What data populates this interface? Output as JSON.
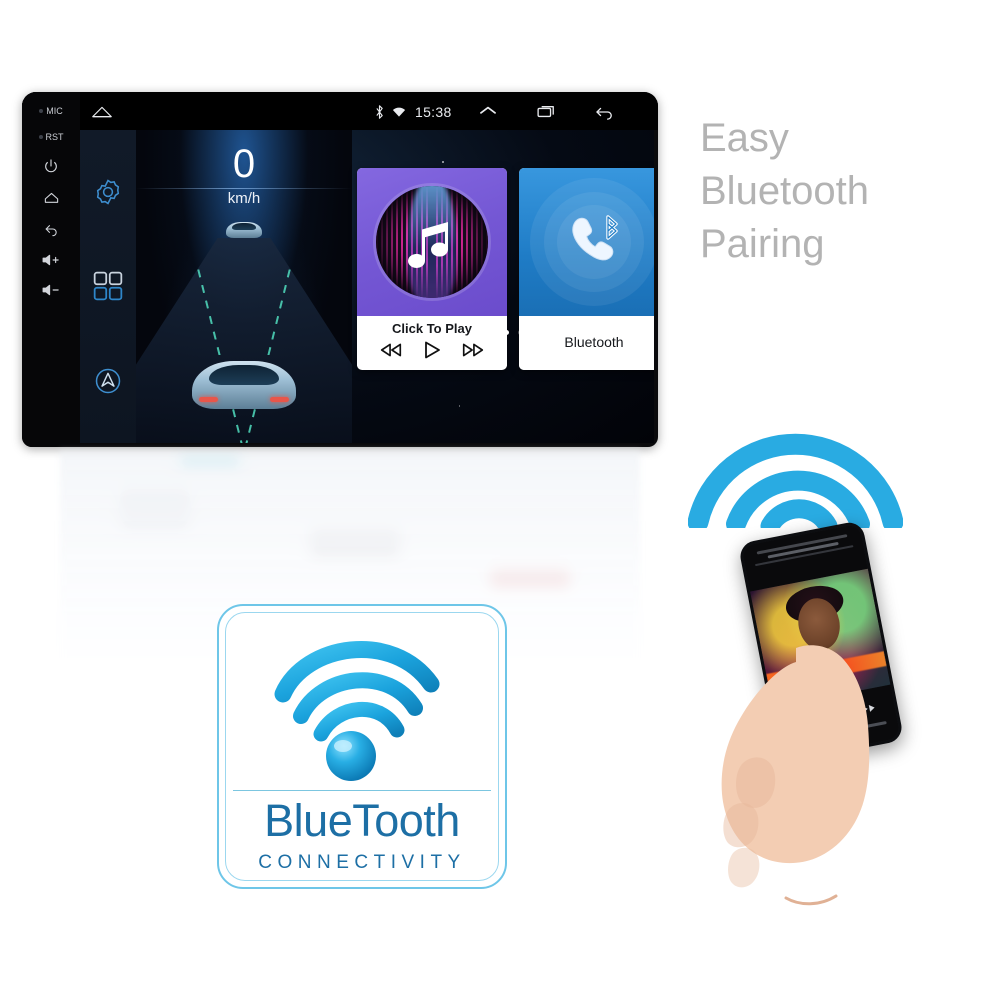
{
  "headline": {
    "line1": "Easy",
    "line2": "Bluetooth",
    "line3": "Pairing",
    "color": "#b3b3b3"
  },
  "head_unit": {
    "bezel": {
      "mic_label": "MIC",
      "rst_label": "RST",
      "buttons": [
        {
          "name": "power-icon",
          "glyph": "⏻"
        },
        {
          "name": "home-icon",
          "glyph": "⌂"
        },
        {
          "name": "back-icon",
          "glyph": "↩"
        },
        {
          "name": "volume-up-label",
          "glyph": "◁+"
        },
        {
          "name": "volume-down-label",
          "glyph": "◁-"
        }
      ]
    },
    "statusbar": {
      "home_icon": "home-outline-icon",
      "bluetooth_icon": "bluetooth-icon",
      "wifi_icon": "wifi-icon",
      "time": "15:38",
      "expand_icon": "chevron-up-icon",
      "recents_icon": "recents-icon",
      "back_icon": "back-arrow-icon"
    },
    "sidebar": {
      "items": [
        {
          "name": "settings-gear-icon",
          "label": "Settings"
        },
        {
          "name": "apps-grid-icon",
          "label": "Apps"
        },
        {
          "name": "navigation-icon",
          "label": "Navigation"
        }
      ]
    },
    "speedometer": {
      "value": "0",
      "unit": "km/h"
    },
    "tiles": [
      {
        "id": "music",
        "label": "Click To Play",
        "art": "music-note-album-art",
        "accent": "#7457d4",
        "controls": [
          {
            "name": "previous-track-button",
            "glyph": "⏮"
          },
          {
            "name": "play-button",
            "glyph": "▷"
          },
          {
            "name": "next-track-button",
            "glyph": "⏭"
          }
        ]
      },
      {
        "id": "bluetooth",
        "label": "Bluetooth",
        "art": "phone-bluetooth-icon",
        "accent": "#1f7cc6"
      }
    ],
    "page_dots": {
      "count": 2,
      "active_index": 0
    }
  },
  "wifi_arcs": {
    "name": "bluetooth-signal-arcs",
    "color": "#29abe2",
    "arc_count": 3
  },
  "phone": {
    "name": "smartphone-in-hand",
    "screen": "music-player-album-art"
  },
  "bt_badge": {
    "wordmark": "BlueTooth",
    "subtitle": "CONNECTIVITY",
    "border_color": "#6ec6e8",
    "text_color": "#1d6fa5",
    "glyph_color": "#1ba3dd",
    "glyph": "bluetooth-connectivity-waves-icon"
  }
}
